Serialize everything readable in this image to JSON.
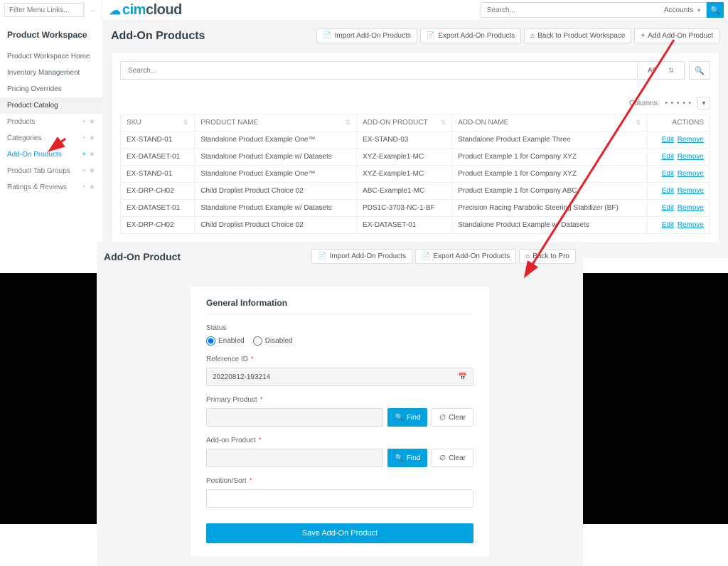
{
  "header": {
    "filter_placeholder": "Filter Menu Links...",
    "search_placeholder": "Search...",
    "account_label": "Accounts",
    "logo": {
      "cim": "cim",
      "cloud": "cloud"
    }
  },
  "sidebar": {
    "title": "Product Workspace",
    "primary": [
      {
        "label": "Product Workspace Home"
      },
      {
        "label": "Inventory Management"
      },
      {
        "label": "Pricing Overrides"
      },
      {
        "label": "Product Catalog",
        "active": true
      }
    ],
    "secondary": [
      {
        "label": "Products"
      },
      {
        "label": "Categories"
      },
      {
        "label": "Add-On Products",
        "selected": true
      },
      {
        "label": "Product Tab Groups"
      },
      {
        "label": "Ratings & Reviews"
      }
    ]
  },
  "page": {
    "title": "Add-On Products",
    "buttons": {
      "import": "Import Add-On Products",
      "export": "Export Add-On Products",
      "back": "Back to Product Workspace",
      "add": "Add Add-On Product"
    },
    "list_search_placeholder": "Search...",
    "all_label": "All",
    "columns_label": "Columns:"
  },
  "table": {
    "headers": {
      "sku": "SKU",
      "pname": "PRODUCT NAME",
      "aoprod": "ADD-ON PRODUCT",
      "aoname": "ADD-ON NAME",
      "actions": "ACTIONS"
    },
    "edit_label": "Edit",
    "remove_label": "Remove",
    "rows": [
      {
        "sku": "EX-STAND-01",
        "pname": "Standalone Product Example One™",
        "aoprod": "EX-STAND-03",
        "aoname": "Standalone Product Example Three"
      },
      {
        "sku": "EX-DATASET-01",
        "pname": "Standalone Product Example w/ Datasets",
        "aoprod": "XYZ-Example1-MC",
        "aoname": "Product Example 1 for Company XYZ"
      },
      {
        "sku": "EX-STAND-01",
        "pname": "Standalone Product Example One™",
        "aoprod": "XYZ-Example1-MC",
        "aoname": "Product Example 1 for Company XYZ"
      },
      {
        "sku": "EX-DRP-CH02",
        "pname": "Child Droplist Product Choice 02",
        "aoprod": "ABC-Example1-MC",
        "aoname": "Product Example 1 for Company ABC"
      },
      {
        "sku": "EX-DATASET-01",
        "pname": "Standalone Product Example w/ Datasets",
        "aoprod": "PDS1C-3703-NC-1-BF",
        "aoname": "Precision Racing Parabolic Steering Stabilizer (BF)"
      },
      {
        "sku": "EX-DRP-CH02",
        "pname": "Child Droplist Product Choice 02",
        "aoprod": "EX-DATASET-01",
        "aoname": "Standalone Product Example w/ Datasets"
      }
    ]
  },
  "form": {
    "title": "Add-On Product",
    "buttons": {
      "import": "Import Add-On Products",
      "export": "Export Add-On Products",
      "back": "Back to Pro"
    },
    "section_title": "General Information",
    "status_label": "Status",
    "enabled": "Enabled",
    "disabled": "Disabled",
    "ref_label": "Reference ID",
    "ref_value": "20220812-193214",
    "primary_label": "Primary Product",
    "addon_label": "Add-on Product",
    "pos_label": "Position/Sort",
    "find": "Find",
    "clear": "Clear",
    "save": "Save Add-On Product"
  }
}
